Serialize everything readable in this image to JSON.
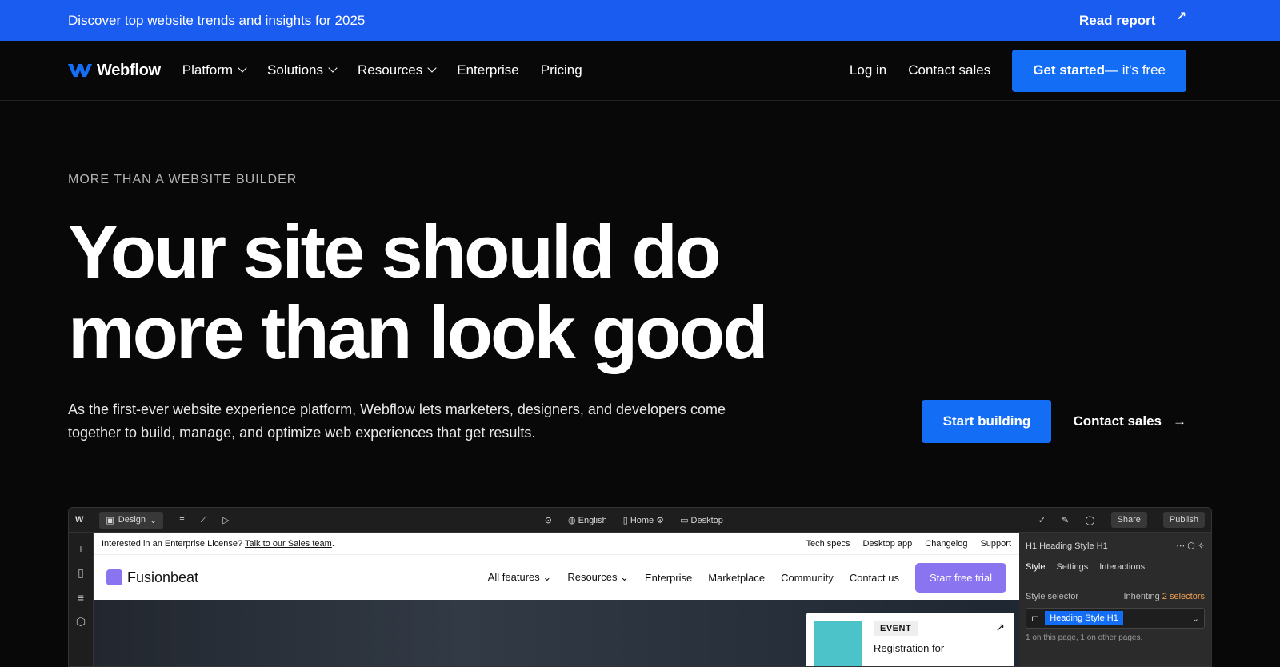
{
  "banner": {
    "text": "Discover top website trends and insights for 2025",
    "cta": "Read report",
    "cta_icon": "arrow-up-right-icon"
  },
  "nav": {
    "logo": "Webflow",
    "links": [
      {
        "label": "Platform",
        "dropdown": true
      },
      {
        "label": "Solutions",
        "dropdown": true
      },
      {
        "label": "Resources",
        "dropdown": true
      },
      {
        "label": "Enterprise",
        "dropdown": false
      },
      {
        "label": "Pricing",
        "dropdown": false
      }
    ],
    "login": "Log in",
    "contact": "Contact sales",
    "cta_bold": "Get started",
    "cta_rest": " — it's free"
  },
  "hero": {
    "eyebrow": "MORE THAN A WEBSITE BUILDER",
    "headline_line1": "Your site should do",
    "headline_line2": "more than look good",
    "subtext": "As the first-ever website experience platform, Webflow lets marketers, designers, and developers come together to build, manage, and optimize web experiences that get results.",
    "primary_cta": "Start building",
    "secondary_cta": "Contact sales"
  },
  "mock": {
    "mode": "Design",
    "language": "English",
    "page": "Home",
    "breakpoint": "Desktop",
    "share": "Share",
    "publish": "Publish",
    "canvas_notice_prefix": "Interested in an Enterprise License? ",
    "canvas_notice_link": "Talk to our Sales team",
    "canvas_notice_suffix": ".",
    "canvas_top_links": [
      "Tech specs",
      "Desktop app",
      "Changelog",
      "Support"
    ],
    "site_logo": "Fusionbeat",
    "site_links": [
      "All features",
      "Resources",
      "Enterprise",
      "Marketplace",
      "Community",
      "Contact us"
    ],
    "site_cta": "Start free trial",
    "event_tag": "EVENT",
    "event_title": "Registration for",
    "panel_tag": "H1",
    "panel_title": "Heading Style H1",
    "panel_tabs": [
      "Style",
      "Settings",
      "Interactions"
    ],
    "style_selector_label": "Style selector",
    "inheriting_prefix": "Inheriting ",
    "inheriting_count": "2 selectors",
    "selector_chip": "Heading Style H1",
    "selector_note": "1 on this page, 1 on other pages."
  },
  "colors": {
    "banner": "#1a5cf0",
    "accent": "#146ef5",
    "background": "#080808"
  }
}
